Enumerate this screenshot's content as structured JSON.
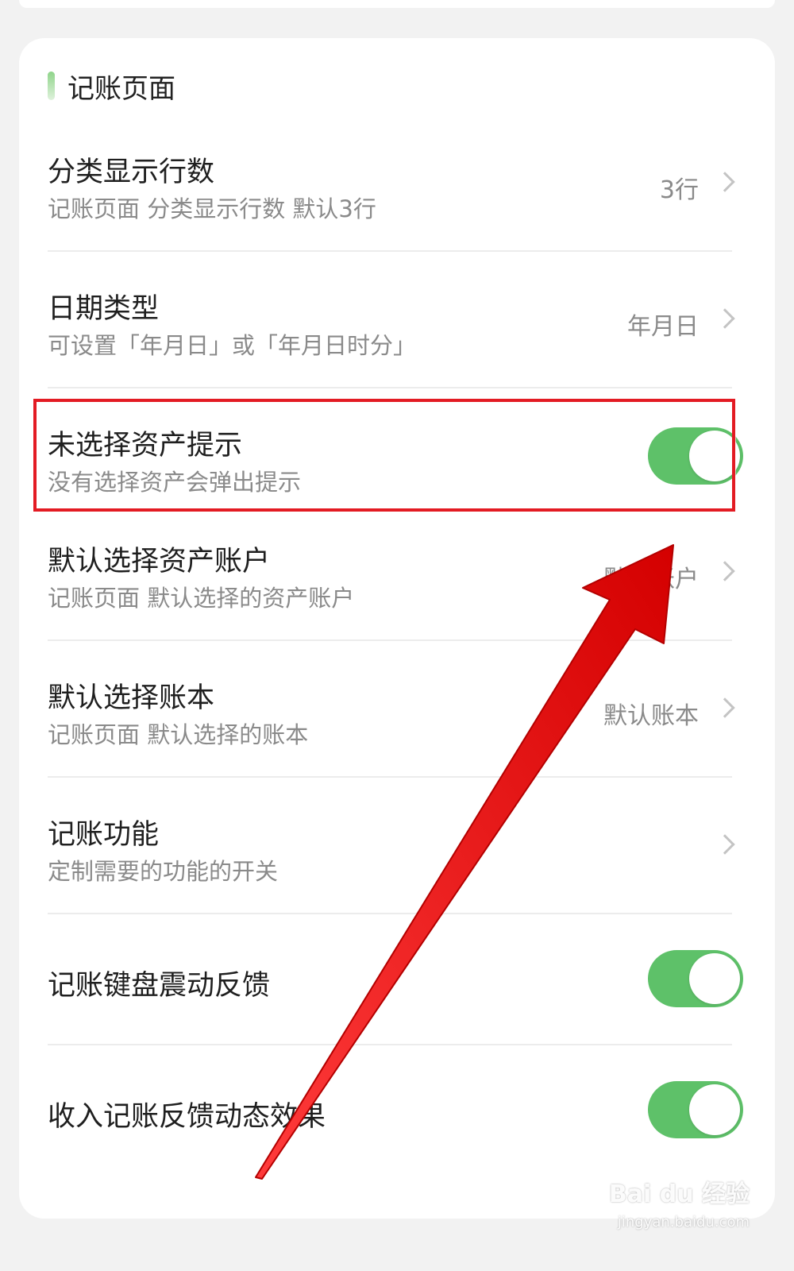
{
  "section": {
    "title": "记账页面"
  },
  "rows": [
    {
      "title": "分类显示行数",
      "subtitle": "记账页面 分类显示行数 默认3行",
      "value": "3行"
    },
    {
      "title": "日期类型",
      "subtitle": "可设置「年月日」或「年月日时分」",
      "value": "年月日"
    },
    {
      "title": "未选择资产提示",
      "subtitle": "没有选择资产会弹出提示",
      "toggle_on": true
    },
    {
      "title": "默认选择资产账户",
      "subtitle": "记账页面 默认选择的资产账户",
      "value": "默认账户"
    },
    {
      "title": "默认选择账本",
      "subtitle": "记账页面 默认选择的账本",
      "value": "默认账本"
    },
    {
      "title": "记账功能",
      "subtitle": "定制需要的功能的开关"
    },
    {
      "title": "记账键盘震动反馈",
      "toggle_on": true
    },
    {
      "title": "收入记账反馈动态效果",
      "toggle_on": true
    }
  ],
  "annotation": {
    "highlight_color": "#e31b23",
    "arrow_color": "#ee1111"
  },
  "colors": {
    "toggle_on": "#5ec169",
    "accent_bar": "#8fd48a"
  },
  "watermark": {
    "main": "Bai du 经验",
    "sub": "jingyan.baidu.com"
  }
}
